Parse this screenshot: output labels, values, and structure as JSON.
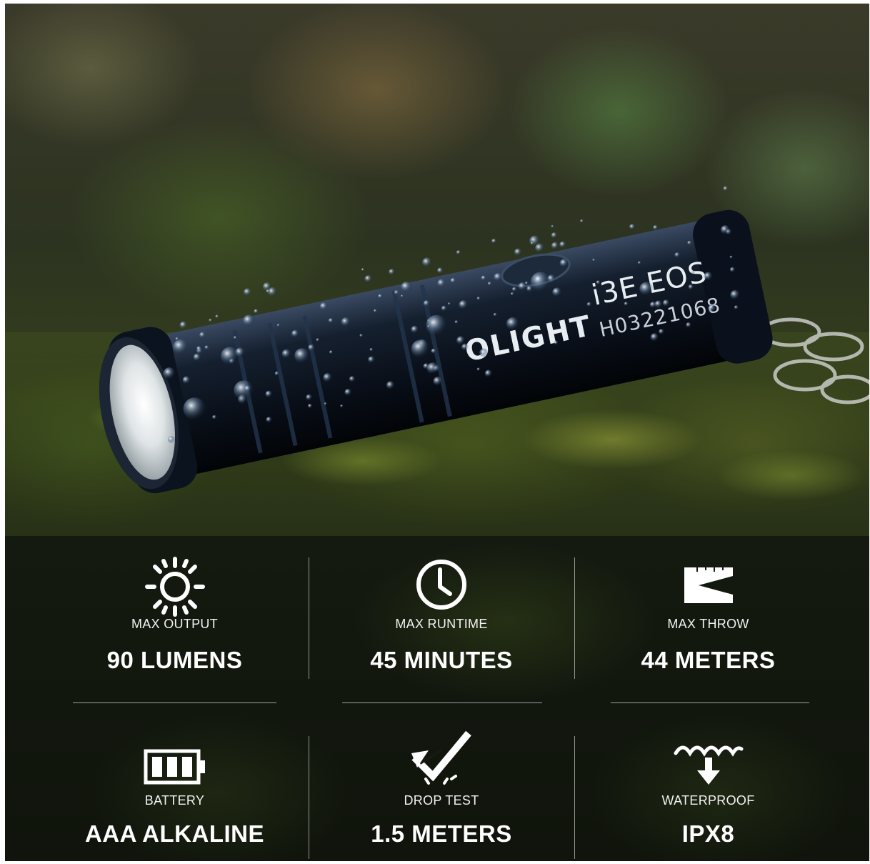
{
  "product": {
    "brand_mark": "OLIGHT",
    "model_mark": "i3E EOS",
    "serial_mark": "H03221068"
  },
  "specs": [
    {
      "icon": "sun-icon",
      "label": "MAX OUTPUT",
      "value": "90 LUMENS"
    },
    {
      "icon": "clock-icon",
      "label": "MAX RUNTIME",
      "value": "45 MINUTES"
    },
    {
      "icon": "beam-throw-icon",
      "label": "MAX THROW",
      "value": "44 METERS"
    },
    {
      "icon": "battery-icon",
      "label": "BATTERY",
      "value": "AAA ALKALINE"
    },
    {
      "icon": "drop-test-icon",
      "label": "DROP TEST",
      "value": "1.5 METERS"
    },
    {
      "icon": "waterproof-icon",
      "label": "WATERPROOF",
      "value": "IPX8"
    }
  ],
  "colors": {
    "text": "#ffffff",
    "panel": "#12170e",
    "flashlight_body": "#0c1422"
  }
}
